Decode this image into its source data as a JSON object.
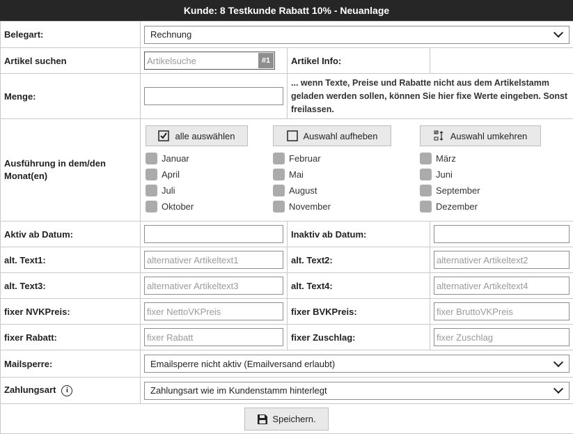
{
  "title": "Kunde: 8 Testkunde Rabatt 10% - Neuanlage",
  "belegart": {
    "label": "Belegart:",
    "value": "Rechnung"
  },
  "artikel": {
    "label": "Artikel suchen",
    "placeholder": "Artikelsuche",
    "badge": "#1",
    "info_label": "Artikel Info:"
  },
  "menge": {
    "label": "Menge:",
    "hint": "... wenn Texte, Preise und Rabatte nicht aus dem Artikelstamm geladen werden sollen, können Sie hier fixe Werte eingeben. Sonst freilassen."
  },
  "ausfuehrung": {
    "label": "Ausführung in dem/den Monat(en)",
    "select_all": "alle auswählen",
    "deselect": "Auswahl aufheben",
    "invert": "Auswahl umkehren",
    "months": [
      "Januar",
      "Februar",
      "März",
      "April",
      "Mai",
      "Juni",
      "Juli",
      "August",
      "September",
      "Oktober",
      "November",
      "Dezember"
    ]
  },
  "aktiv_ab": {
    "label": "Aktiv ab Datum:"
  },
  "inaktiv_ab": {
    "label": "Inaktiv ab Datum:"
  },
  "text1": {
    "label": "alt. Text1:",
    "placeholder": "alternativer Artikeltext1"
  },
  "text2": {
    "label": "alt. Text2:",
    "placeholder": "alternativer Artikeltext2"
  },
  "text3": {
    "label": "alt. Text3:",
    "placeholder": "alternativer Artikeltext3"
  },
  "text4": {
    "label": "alt. Text4:",
    "placeholder": "alternativer Artikeltext4"
  },
  "nvk": {
    "label": "fixer NVKPreis:",
    "placeholder": "fixer NettoVKPreis"
  },
  "bvk": {
    "label": "fixer BVKPreis:",
    "placeholder": "fixer BruttoVKPreis"
  },
  "rabatt": {
    "label": "fixer Rabatt:",
    "placeholder": "fixer Rabatt"
  },
  "zuschlag": {
    "label": "fixer Zuschlag:",
    "placeholder": "fixer Zuschlag"
  },
  "mailsperre": {
    "label": "Mailsperre:",
    "value": "Emailsperre nicht aktiv (Emailversand erlaubt)"
  },
  "zahlungsart": {
    "label": "Zahlungsart",
    "value": "Zahlungsart wie im Kundenstamm hinterlegt"
  },
  "save_label": "Speichern."
}
